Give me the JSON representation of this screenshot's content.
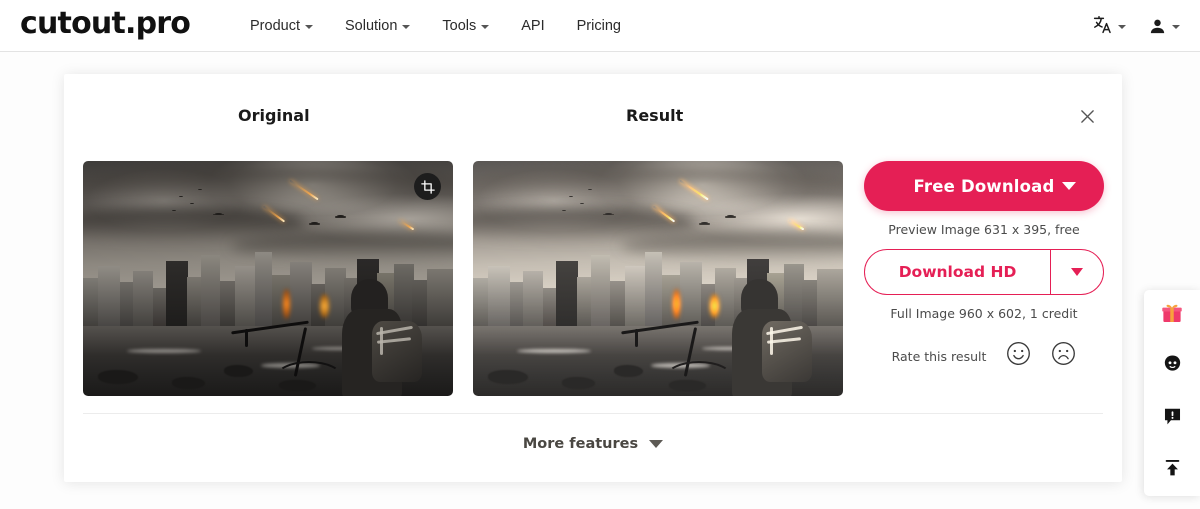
{
  "header": {
    "logo": "cutout.pro",
    "nav": [
      {
        "label": "Product",
        "has_chevron": true
      },
      {
        "label": "Solution",
        "has_chevron": true
      },
      {
        "label": "Tools",
        "has_chevron": true
      },
      {
        "label": "API",
        "has_chevron": false
      },
      {
        "label": "Pricing",
        "has_chevron": false
      }
    ],
    "right": [
      {
        "icon": "language-translate-icon",
        "has_chevron": true
      },
      {
        "icon": "user-account-icon",
        "has_chevron": true
      }
    ]
  },
  "card": {
    "close_icon": "close-icon",
    "original_title": "Original",
    "result_title": "Result",
    "original_image": {
      "alt": "Apocalyptic city skyline with meteors, hooded figure with backpack and bicycle on shoreline",
      "crop_icon": "crop-icon"
    },
    "result_image": {
      "alt": "Brightened and enhanced version of the apocalyptic city skyline photo"
    },
    "actions": {
      "free_download_label": "Free Download",
      "free_download_caption": "Preview Image 631 x 395, free",
      "download_hd_label": "Download HD",
      "download_hd_caption": "Full Image 960 x 602, 1 credit",
      "rate_label": "Rate this result",
      "rate_good_icon": "smiley-face-icon",
      "rate_bad_icon": "sad-face-icon",
      "dropdown_icon": "chevron-down-icon"
    },
    "footer": {
      "more_features_label": "More features",
      "more_features_icon": "chevron-down-icon"
    }
  },
  "rail": [
    {
      "icon": "gift-icon",
      "name": "rewards"
    },
    {
      "icon": "support-face-icon",
      "name": "customer-support"
    },
    {
      "icon": "feedback-bubble-icon",
      "name": "feedback"
    },
    {
      "icon": "back-to-top-icon",
      "name": "back-to-top"
    }
  ],
  "colors": {
    "accent": "#e51f55",
    "text": "#2b2b2b",
    "muted": "#4b4b4b",
    "card_bg": "#ffffff",
    "page_bg": "#fdfdfd"
  }
}
